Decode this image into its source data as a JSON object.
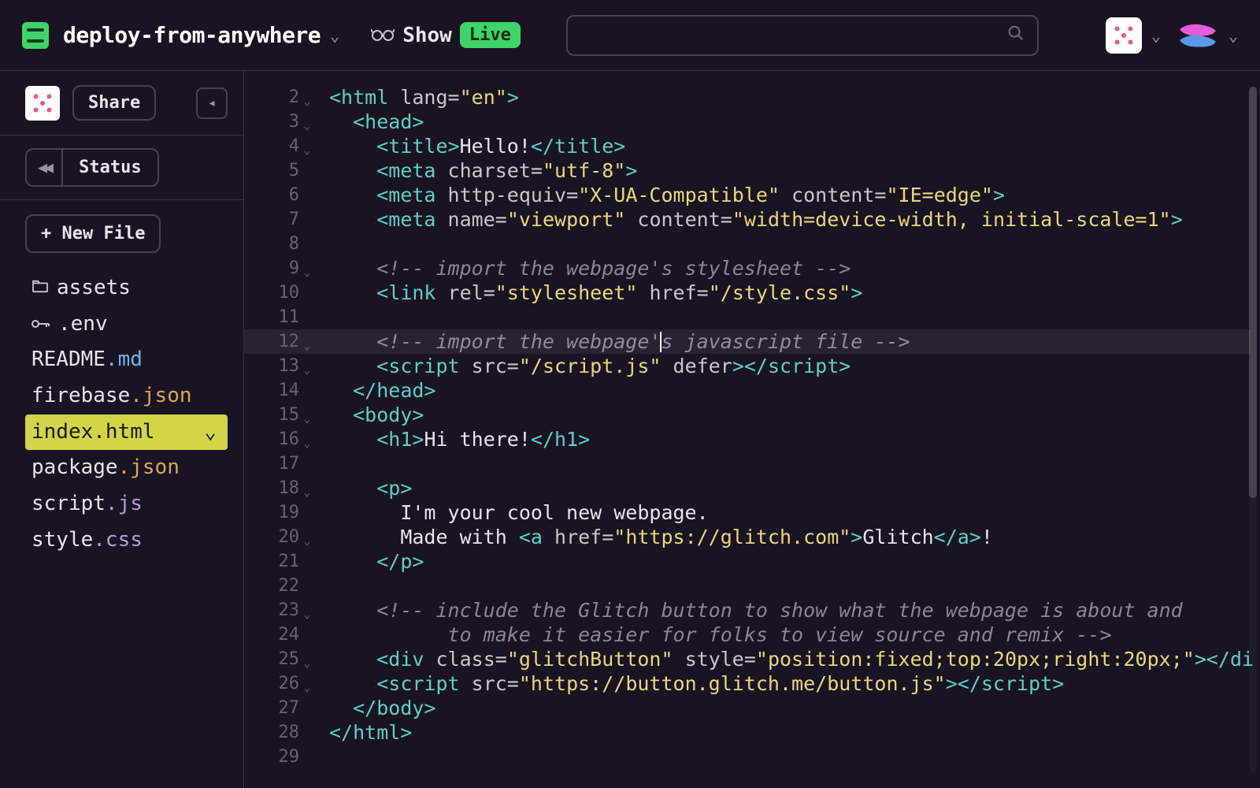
{
  "header": {
    "project_name": "deploy-from-anywhere",
    "show_label": "Show",
    "live_label": "Live",
    "search_placeholder": ""
  },
  "sidebar": {
    "share_label": "Share",
    "status_label": "Status",
    "newfile_label": "+ New File",
    "files": [
      {
        "icon": "folder",
        "name": "assets",
        "ext": ""
      },
      {
        "icon": "key",
        "name": ".env",
        "ext": ""
      },
      {
        "icon": "",
        "name": "README",
        "ext": ".md",
        "ext_class": "ext-blue"
      },
      {
        "icon": "",
        "name": "firebase",
        "ext": ".json",
        "ext_class": "ext-orange"
      },
      {
        "icon": "",
        "name": "index",
        "ext": ".html",
        "ext_class": "ext-orange",
        "active": true
      },
      {
        "icon": "",
        "name": "package",
        "ext": ".json",
        "ext_class": "ext-orange"
      },
      {
        "icon": "",
        "name": "script",
        "ext": ".js",
        "ext_class": "ext-purple"
      },
      {
        "icon": "",
        "name": "style",
        "ext": ".css",
        "ext_class": "ext-purple"
      }
    ]
  },
  "editor": {
    "active_file": "index.html",
    "highlighted_line": 12,
    "cursor_col": 28,
    "lines": [
      {
        "n": 2,
        "fold": true,
        "html": "<span class='tag'>&lt;html</span> <span class='attr'>lang=</span><span class='str'>\"en\"</span><span class='tag'>&gt;</span>"
      },
      {
        "n": 3,
        "fold": true,
        "html": "  <span class='tag'>&lt;head&gt;</span>"
      },
      {
        "n": 4,
        "fold": true,
        "html": "    <span class='tag'>&lt;title&gt;</span><span class='txt'>Hello!</span><span class='tag'>&lt;/title&gt;</span>"
      },
      {
        "n": 5,
        "fold": false,
        "html": "    <span class='tag'>&lt;meta</span> <span class='attr'>charset=</span><span class='str'>\"utf-8\"</span><span class='tag'>&gt;</span>"
      },
      {
        "n": 6,
        "fold": false,
        "html": "    <span class='tag'>&lt;meta</span> <span class='attr'>http-equiv=</span><span class='str'>\"X-UA-Compatible\"</span> <span class='attr'>content=</span><span class='str'>\"IE=edge\"</span><span class='tag'>&gt;</span>"
      },
      {
        "n": 7,
        "fold": false,
        "html": "    <span class='tag'>&lt;meta</span> <span class='attr'>name=</span><span class='str'>\"viewport\"</span> <span class='attr'>content=</span><span class='str'>\"width=device-width, initial-scale=1\"</span><span class='tag'>&gt;</span>"
      },
      {
        "n": 8,
        "fold": false,
        "html": ""
      },
      {
        "n": 9,
        "fold": true,
        "html": "    <span class='cmt'>&lt;!-- import the webpage's stylesheet --&gt;</span>"
      },
      {
        "n": 10,
        "fold": false,
        "html": "    <span class='tag'>&lt;link</span> <span class='attr'>rel=</span><span class='str'>\"stylesheet\"</span> <span class='attr'>href=</span><span class='str'>\"/style.css\"</span><span class='tag'>&gt;</span>"
      },
      {
        "n": 11,
        "fold": false,
        "html": ""
      },
      {
        "n": 12,
        "fold": true,
        "html": "    <span class='cmt'>&lt;!-- import the webpage's javascript file --&gt;</span>"
      },
      {
        "n": 13,
        "fold": true,
        "html": "    <span class='tag'>&lt;script</span> <span class='attr'>src=</span><span class='str'>\"/script.js\"</span> <span class='attr'>defer</span><span class='tag'>&gt;&lt;/script&gt;</span>"
      },
      {
        "n": 14,
        "fold": false,
        "html": "  <span class='tag'>&lt;/head&gt;</span>"
      },
      {
        "n": 15,
        "fold": true,
        "html": "  <span class='tag'>&lt;body&gt;</span>"
      },
      {
        "n": 16,
        "fold": true,
        "html": "    <span class='tag'>&lt;h1&gt;</span><span class='txt'>Hi there!</span><span class='tag'>&lt;/h1&gt;</span>"
      },
      {
        "n": 17,
        "fold": false,
        "html": ""
      },
      {
        "n": 18,
        "fold": true,
        "html": "    <span class='tag'>&lt;p&gt;</span>"
      },
      {
        "n": 19,
        "fold": false,
        "html": "      <span class='txt'>I'm your cool new webpage.</span>"
      },
      {
        "n": 20,
        "fold": true,
        "html": "      <span class='txt'>Made with </span><span class='tag'>&lt;a</span> <span class='attr'>href=</span><span class='str'>\"https://glitch.com\"</span><span class='tag'>&gt;</span><span class='txt'>Glitch</span><span class='tag'>&lt;/a&gt;</span><span class='txt'>!</span>"
      },
      {
        "n": 21,
        "fold": false,
        "html": "    <span class='tag'>&lt;/p&gt;</span>"
      },
      {
        "n": 22,
        "fold": false,
        "html": ""
      },
      {
        "n": 23,
        "fold": true,
        "html": "    <span class='cmt'>&lt;!-- include the Glitch button to show what the webpage is about and</span>"
      },
      {
        "n": 24,
        "fold": false,
        "html": "          <span class='cmt'>to make it easier for folks to view source and remix --&gt;</span>"
      },
      {
        "n": 25,
        "fold": true,
        "html": "    <span class='tag'>&lt;div</span> <span class='attr'>class=</span><span class='str'>\"glitchButton\"</span> <span class='attr'>style=</span><span class='str'>\"position:fixed;top:20px;right:20px;\"</span><span class='tag'>&gt;&lt;/di</span>"
      },
      {
        "n": 26,
        "fold": true,
        "html": "    <span class='tag'>&lt;script</span> <span class='attr'>src=</span><span class='str'>\"https://button.glitch.me/button.js\"</span><span class='tag'>&gt;&lt;/script&gt;</span>"
      },
      {
        "n": 27,
        "fold": false,
        "html": "  <span class='tag'>&lt;/body&gt;</span>"
      },
      {
        "n": 28,
        "fold": false,
        "html": "<span class='tag'>&lt;/html&gt;</span>"
      },
      {
        "n": 29,
        "fold": false,
        "html": ""
      }
    ]
  }
}
